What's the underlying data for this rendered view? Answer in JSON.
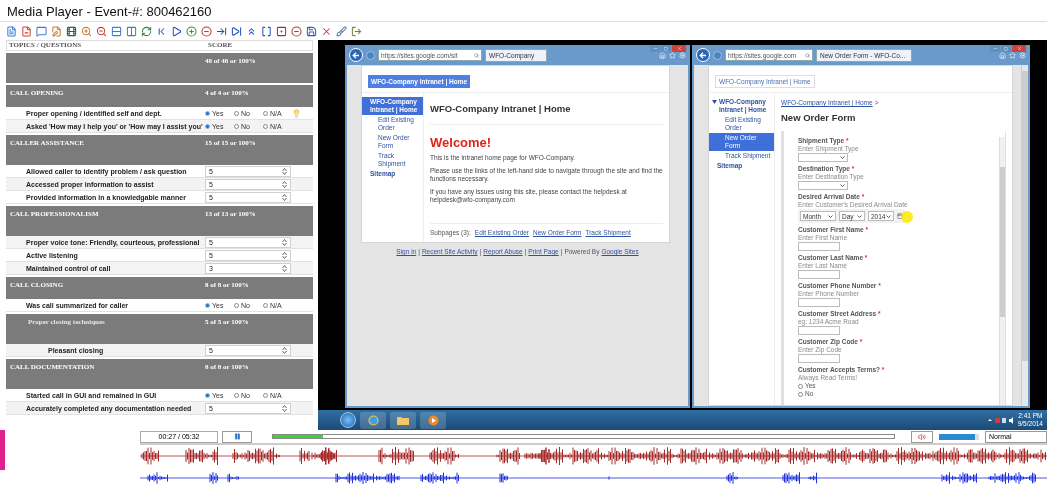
{
  "window": {
    "title": "Media Player - Event-#: 800462160"
  },
  "evaluation": {
    "columns": [
      "TOPICS / QUESTIONS",
      "SCORE"
    ],
    "total": "48 of 48 or 100%",
    "sections": [
      {
        "title": "CALL OPENING",
        "score": "4 of 4 or 100%",
        "children": [
          {
            "kind": "radio",
            "text": "Proper opening / identified self and dept.",
            "tip": true,
            "options": [
              {
                "label": "Yes",
                "selected": true
              },
              {
                "label": "No",
                "selected": false
              },
              {
                "label": "N/A",
                "selected": false
              }
            ]
          },
          {
            "kind": "radio",
            "text": "Asked 'How may I help you' or 'How may I assist you'",
            "tip": false,
            "options": [
              {
                "label": "Yes",
                "selected": true
              },
              {
                "label": "No",
                "selected": false
              },
              {
                "label": "N/A",
                "selected": false
              }
            ]
          }
        ]
      },
      {
        "title": "CALLER ASSISTANCE",
        "score": "15 of 15 or 100%",
        "children": [
          {
            "kind": "select",
            "text": "Allowed caller to identify problem / ask question",
            "tip": false,
            "value": "5"
          },
          {
            "kind": "select",
            "text": "Accessed proper information to assist",
            "tip": false,
            "value": "5"
          },
          {
            "kind": "select",
            "text": "Provided information in a knowledgable manner",
            "tip": false,
            "value": "5"
          }
        ]
      },
      {
        "title": "CALL PROFESSIONALISM",
        "score": "13 of 13 or 100%",
        "children": [
          {
            "kind": "select",
            "text": "Proper voice tone: Friendly, courteous, professional",
            "tip": false,
            "value": "5"
          },
          {
            "kind": "select",
            "text": "Active listening",
            "tip": false,
            "value": "5"
          },
          {
            "kind": "select",
            "text": "Maintained control of call",
            "tip": false,
            "value": "3"
          }
        ]
      },
      {
        "title": "CALL CLOSING",
        "score": "8 of 8 or 100%",
        "children": [
          {
            "kind": "radio",
            "text": "Was call summarized for caller",
            "tip": false,
            "options": [
              {
                "label": "Yes",
                "selected": true
              },
              {
                "label": "No",
                "selected": false
              },
              {
                "label": "N/A",
                "selected": false
              }
            ]
          },
          {
            "kind": "group",
            "title": "Proper closing techniques",
            "score": "5 of 5 or 100%",
            "children": [
              {
                "kind": "select",
                "text": "Pleasant closing",
                "tip": false,
                "value": "5"
              }
            ]
          }
        ]
      },
      {
        "title": "CALL DOCUMENTATION",
        "score": "8 of 8 or 100%",
        "children": [
          {
            "kind": "radio",
            "text": "Started call in GUI and remained in GUI",
            "tip": false,
            "options": [
              {
                "label": "Yes",
                "selected": true
              },
              {
                "label": "No",
                "selected": false
              },
              {
                "label": "N/A",
                "selected": false
              }
            ]
          },
          {
            "kind": "select",
            "text": "Accurately completed any documentation needed",
            "tip": false,
            "value": "5"
          }
        ]
      }
    ]
  },
  "screen_recording": {
    "browser_left": {
      "address": "https://sites.google.com/sit",
      "tab": "WFO-Company",
      "site_button": "WFO-Company Intranet | Home",
      "nav": [
        {
          "label": "WFO-Company Intranet | Home",
          "selected": true,
          "expanded": false,
          "children": [
            {
              "label": "Edit Existing Order",
              "selected": false
            },
            {
              "label": "New Order Form",
              "selected": false
            },
            {
              "label": "Track Shipment",
              "selected": false
            }
          ]
        },
        {
          "label": "Sitemap",
          "selected": false,
          "expanded": false
        }
      ],
      "heading": "WFO-Company Intranet | Home",
      "welcome": "Welcome!",
      "paragraphs": [
        "This is the intranet home page for WFO-Company.",
        "Please use the links of the left-hand side to navigate through the site and find the functions necessary.",
        "If you have any issues using this site, please contact the helpdesk at helpdesk@wfo-company.com"
      ],
      "subpages_label": "Subpages (3):",
      "subpages": [
        "Edit Existing Order",
        "New Order Form",
        "Track Shipment"
      ],
      "footer": [
        {
          "kind": "link",
          "text": "Sign in"
        },
        {
          "kind": "text",
          "text": "|"
        },
        {
          "kind": "link",
          "text": "Recent Site Activity"
        },
        {
          "kind": "text",
          "text": "|"
        },
        {
          "kind": "link",
          "text": "Report Abuse"
        },
        {
          "kind": "text",
          "text": "|"
        },
        {
          "kind": "link",
          "text": "Print Page"
        },
        {
          "kind": "text",
          "text": "|"
        },
        {
          "kind": "text",
          "text": "Powered By"
        },
        {
          "kind": "link",
          "text": "Google Sites"
        }
      ]
    },
    "browser_right": {
      "address": "https://sites.google.com",
      "tab": "New Order Form - WFO-Co...",
      "site_link": "WFO-Company Intranet | Home",
      "nav": [
        {
          "label": "WFO-Company Intranet | Home",
          "selected": false,
          "expanded": true,
          "children": [
            {
              "label": "Edit Existing Order",
              "selected": false
            },
            {
              "label": "New Order Form",
              "selected": true
            },
            {
              "label": "Track Shipment",
              "selected": false
            }
          ]
        },
        {
          "label": "Sitemap",
          "selected": false,
          "expanded": false
        }
      ],
      "breadcrumb": "WFO-Company Intranet | Home",
      "breadcrumb_sep": ">",
      "heading": "New Order Form",
      "form": [
        {
          "kind": "select",
          "label": "Shipment Type",
          "required_mark": "*",
          "hint": "Enter Shipment Type"
        },
        {
          "kind": "select",
          "label": "Destination Type",
          "required_mark": "*",
          "hint": "Enter Destination Type"
        },
        {
          "kind": "date",
          "label": "Desired Arrival Date",
          "required_mark": "*",
          "hint": "Enter Customer's Desired Arrival Date",
          "parts": [
            "Month",
            "Day",
            "2014"
          ]
        },
        {
          "kind": "text",
          "label": "Customer First Name",
          "required_mark": "*",
          "hint": "Enter First Name"
        },
        {
          "kind": "text",
          "label": "Customer Last Name",
          "required_mark": "*",
          "hint": "Enter Last Name"
        },
        {
          "kind": "text",
          "label": "Customer Phone Number",
          "required_mark": "*",
          "hint": "Enter Phone Number"
        },
        {
          "kind": "text",
          "label": "Customer Street Address",
          "required_mark": "*",
          "hint": "eg: 1234 Acme Road"
        },
        {
          "kind": "text",
          "label": "Customer Zip Code",
          "required_mark": "*",
          "hint": "Enter Zip Code"
        },
        {
          "kind": "radio",
          "label": "Customer Accepts Terms?",
          "required_mark": "*",
          "hint": "Always Read Terms!",
          "options": [
            {
              "label": "Yes",
              "selected": false
            },
            {
              "label": "No",
              "selected": false
            }
          ]
        }
      ]
    },
    "taskbar": {
      "time": "2:41 PM",
      "date": "9/5/2014"
    }
  },
  "player": {
    "position": "00:27 / 05:32",
    "progress": {
      "level": 0.08
    },
    "volume": {
      "level": 0.9
    },
    "speed": "Normal"
  }
}
